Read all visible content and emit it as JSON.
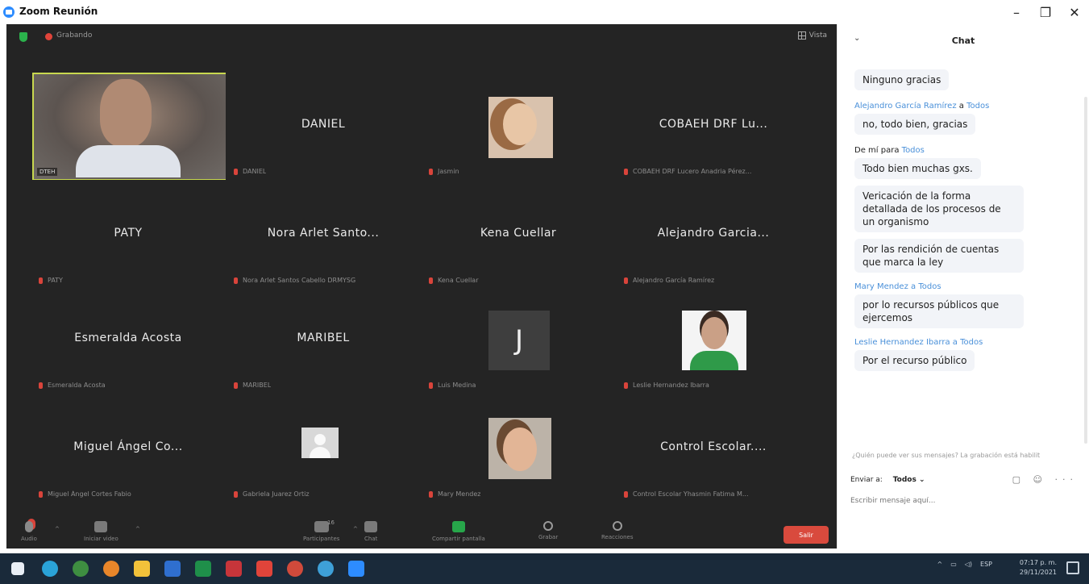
{
  "window": {
    "title": "Zoom Reunión",
    "minimize": "–",
    "restore": "❐",
    "close": "✕"
  },
  "meeting": {
    "recording_label": "Grabando",
    "view_label": "Vista",
    "tiles": [
      {
        "name": "",
        "label": "DTEH",
        "type": "video"
      },
      {
        "name": "DANIEL",
        "label": "DANIEL"
      },
      {
        "name": "",
        "label": "Jasmin",
        "type": "photo"
      },
      {
        "name": "COBAEH DRF Lu...",
        "label": "COBAEH DRF Lucero Anadria Pérez..."
      },
      {
        "name": "PATY",
        "label": "PATY"
      },
      {
        "name": "Nora Arlet Santo...",
        "label": "Nora Arlet Santos Cabello DRMYSG"
      },
      {
        "name": "Kena Cuellar",
        "label": "Kena Cuellar"
      },
      {
        "name": "Alejandro Garcia...",
        "label": "Alejandro García Ramírez"
      },
      {
        "name": "Esmeralda Acosta",
        "label": "Esmeralda Acosta"
      },
      {
        "name": "MARIBEL",
        "label": "MARIBEL"
      },
      {
        "name": "",
        "label": "Luis Medina",
        "type": "avatar",
        "initial": "J"
      },
      {
        "name": "",
        "label": "Leslie Hernandez Ibarra",
        "type": "photo"
      },
      {
        "name": "Miguel Ángel Co...",
        "label": "Miguel Ángel Cortes Fabio"
      },
      {
        "name": "",
        "label": "Gabriela Juarez Ortiz",
        "type": "generic"
      },
      {
        "name": "",
        "label": "Mary Mendez",
        "type": "photo"
      },
      {
        "name": "Control Escolar....",
        "label": "Control Escolar Yhasmin Fatima M..."
      }
    ],
    "toolbar": {
      "audio": "Audio",
      "video": "Iniciar video",
      "participants": "Participantes",
      "participants_count": "16",
      "chat": "Chat",
      "share": "Compartir pantalla",
      "record": "Grabar",
      "reactions": "Reacciones",
      "leave": "Salir"
    }
  },
  "chat": {
    "title": "Chat",
    "messages": [
      {
        "sender": "",
        "to": "",
        "texts": [
          "Ninguno gracias"
        ]
      },
      {
        "sender": "Alejandro García Ramírez",
        "to_word": "a",
        "to": "Todos",
        "texts": [
          "no, todo bien, gracias"
        ]
      },
      {
        "sender": "De mí",
        "to_word": "para",
        "to": "Todos",
        "texts": [
          "Todo bien muchas gxs.",
          "Vericación de la forma detallada de los procesos de un organismo",
          "Por las rendición de cuentas que marca la ley"
        ]
      },
      {
        "sender": "Mary Mendez",
        "to_word": "a",
        "to": "Todos",
        "texts": [
          "por lo recursos públicos que ejercemos"
        ]
      },
      {
        "sender": "Leslie Hernandez Ibarra",
        "to_word": "a",
        "to": "Todos",
        "texts": [
          "Por el recurso público"
        ]
      }
    ],
    "notice": "¿Quién puede ver sus mensajes? La grabación está habilit",
    "send_to_label": "Enviar a:",
    "send_to_value": "Todos ⌄",
    "tools": "▢ ☺ ···",
    "input_placeholder": "Escribir mensaje aquí..."
  },
  "taskbar": {
    "language": "ESP",
    "time": "07:17 p. m.",
    "date": "29/11/2021",
    "app_colors": [
      "#2f7fd3",
      "#2aa3d8",
      "#e8862a",
      "#f2c23a",
      "#2f6fcf",
      "#1f8f4a",
      "#c7353a",
      "#e0443a",
      "#d04a3b",
      "#3ea0d8",
      "#2d8cff"
    ]
  }
}
